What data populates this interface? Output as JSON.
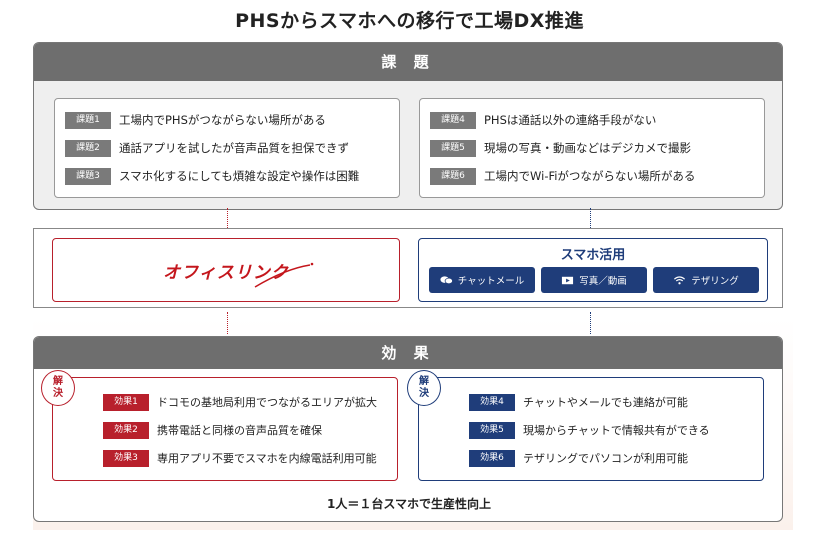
{
  "title": "PHSからスマホへの移行で工場DX推進",
  "problems": {
    "heading": "課 題",
    "left": [
      {
        "tag": "課題1",
        "text": "工場内でPHSがつながらない場所がある"
      },
      {
        "tag": "課題2",
        "text": "通話アプリを試したが音声品質を担保できず"
      },
      {
        "tag": "課題3",
        "text": "スマホ化するにしても煩雑な設定や操作は困難"
      }
    ],
    "right": [
      {
        "tag": "課題4",
        "text": "PHSは通話以外の連絡手段がない"
      },
      {
        "tag": "課題5",
        "text": "現場の写真・動画などはデジカメで撮影"
      },
      {
        "tag": "課題6",
        "text": "工場内でWi-Fiがつながらない場所がある"
      }
    ]
  },
  "solutions": {
    "office_logo": "オフィスリンク",
    "smart_title": "スマホ活用",
    "buttons": [
      {
        "label": "チャットメール",
        "icon": "chat-icon"
      },
      {
        "label": "写真／動画",
        "icon": "video-icon"
      },
      {
        "label": "テザリング",
        "icon": "wifi-icon"
      }
    ]
  },
  "effects": {
    "heading": "効 果",
    "seal_top": "解",
    "seal_bottom": "決",
    "left": [
      {
        "tag": "効果1",
        "text": "ドコモの基地局利用でつながるエリアが拡大"
      },
      {
        "tag": "効果2",
        "text": "携帯電話と同様の音声品質を確保"
      },
      {
        "tag": "効果3",
        "text": "専用アプリ不要でスマホを内線電話利用可能"
      }
    ],
    "right": [
      {
        "tag": "効果4",
        "text": "チャットやメールでも連絡が可能"
      },
      {
        "tag": "効果5",
        "text": "現場からチャットで情報共有ができる"
      },
      {
        "tag": "効果6",
        "text": "テザリングでパソコンが利用可能"
      }
    ],
    "footer": "1人＝１台スマホで生産性向上"
  },
  "colors": {
    "red": "#b8202c",
    "blue": "#1f3d7a",
    "gray": "#6e6e6e"
  }
}
